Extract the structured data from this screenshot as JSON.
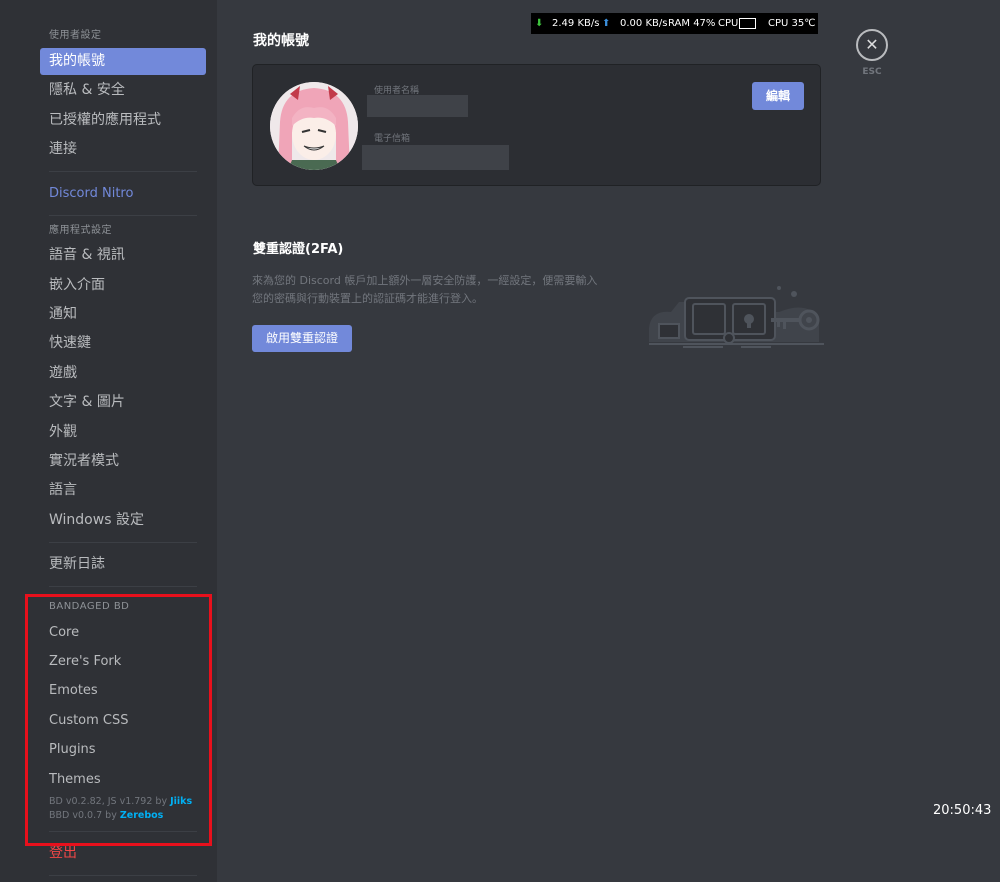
{
  "sidebar": {
    "user_settings_header": "使用者設定",
    "user_items": [
      "我的帳號",
      "隱私 & 安全",
      "已授權的應用程式",
      "連接"
    ],
    "nitro": "Discord Nitro",
    "app_settings_header": "應用程式設定",
    "app_items": [
      "語音 & 視訊",
      "嵌入介面",
      "通知",
      "快速鍵",
      "遊戲",
      "文字 & 圖片",
      "外觀",
      "實況者模式",
      "語言",
      "Windows 設定"
    ],
    "changelog": "更新日誌",
    "bd_header": "BANDAGED BD",
    "bd_items": [
      "Core",
      "Zere's Fork",
      "Emotes",
      "Custom CSS",
      "Plugins",
      "Themes"
    ],
    "bd_version_line1_prefix": "BD v0.2.82, JS v1.792 by ",
    "bd_version_line1_author": "Jiiks",
    "bd_version_line2_prefix": "BBD v0.0.7 by ",
    "bd_version_line2_author": "Zerebos",
    "logout": "登出"
  },
  "main": {
    "title": "我的帳號",
    "username_label": "使用者名稱",
    "email_label": "電子信箱",
    "edit_button": "編輯",
    "twofa_title": "雙重認證(2FA)",
    "twofa_desc_line1": "來為您的 Discord 帳戶加上額外一層安全防護，一經設定，便需要輸入",
    "twofa_desc_line2": "您的密碼與行動裝置上的認証碼才能進行登入。",
    "enable_twofa_button": "啟用雙重認證",
    "close_label": "ESC"
  },
  "monitor": {
    "download": "2.49 KB/s",
    "upload": "0.00 KB/s",
    "ram": "RAM 47%",
    "cpu_label": "CPU",
    "cpu_temp": "CPU 35℃"
  },
  "clock": "20:50:43",
  "colors": {
    "accent": "#7289da",
    "danger": "#f04747",
    "highlight_box": "#e8101c"
  }
}
